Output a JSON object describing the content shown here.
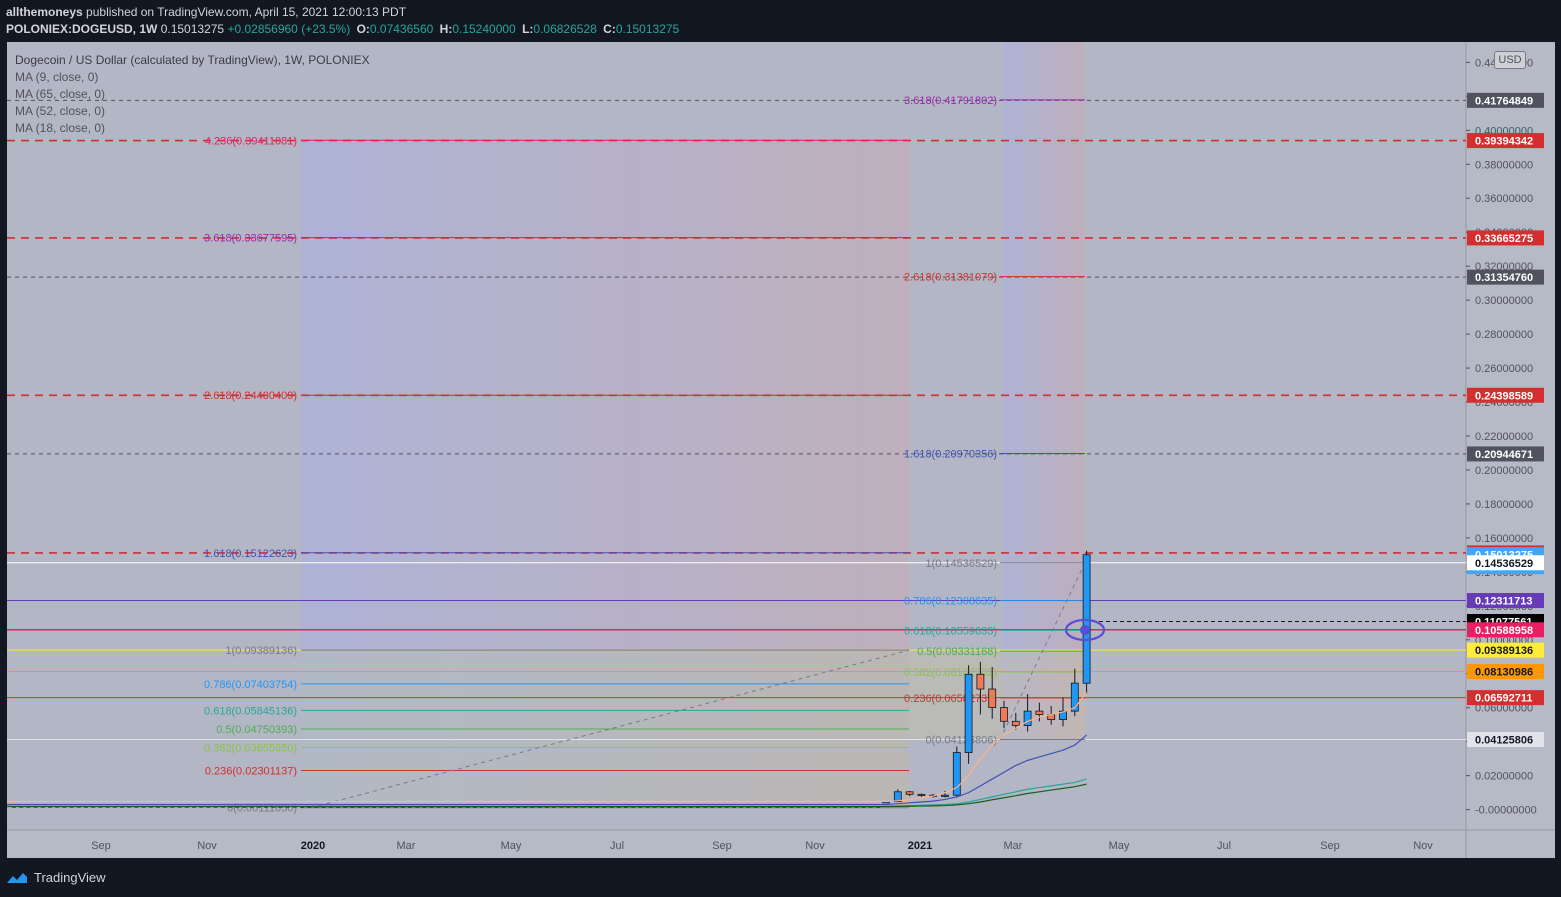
{
  "header": {
    "author": "allthemoneys",
    "published": "published on TradingView.com, April 15, 2021 12:00:13 PDT",
    "symbol": "POLONIEX:DOGEUSD, 1W",
    "last": "0.15013275",
    "change": "+0.02856960 (+23.5%)",
    "o_label": "O:",
    "o": "0.07436560",
    "h_label": "H:",
    "h": "0.15240000",
    "l_label": "L:",
    "l": "0.06826528",
    "c_label": "C:",
    "c": "0.15013275"
  },
  "legend": {
    "title": "Dogecoin / US Dollar (calculated by TradingView), 1W, POLONIEX",
    "ma1": "MA (9, close, 0)",
    "ma2": "MA (65, close, 0)",
    "ma3": "MA (52, close, 0)",
    "ma4": "MA (18, close, 0)"
  },
  "currency": "USD",
  "footer": {
    "brand": "TradingView"
  },
  "colors": {
    "background": "#b3b6c4",
    "frame": "#131722",
    "up": "#2196f3",
    "down": "#ef7b56",
    "dashed_red": "#d32f2f",
    "dashed_dark": "#50535e"
  },
  "chart_data": {
    "type": "candlestick",
    "ylim": [
      -0.012,
      0.452
    ],
    "y_ticks": [
      0.44,
      0.42,
      0.4,
      0.38,
      0.36,
      0.34,
      0.32,
      0.3,
      0.28,
      0.26,
      0.24,
      0.22,
      0.2,
      0.18,
      0.16,
      0.14,
      0.12,
      0.1,
      0.08,
      0.06,
      0.04,
      0.02,
      0.0
    ],
    "y_tick_labels": [
      "0.44000000",
      "0.42000000",
      "0.40000000",
      "0.38000000",
      "0.36000000",
      "0.34000000",
      "0.32000000",
      "0.30000000",
      "0.28000000",
      "0.26000000",
      "0.24000000",
      "0.22000000",
      "0.20000000",
      "0.18000000",
      "0.16000000",
      "0.14000000",
      "0.12000000",
      "0.10000000",
      "0.08000000",
      "0.06000000",
      "0.04000000",
      "0.02000000",
      "-0.00000000"
    ],
    "x_labels": [
      "Sep",
      "Nov",
      "2020",
      "Mar",
      "May",
      "Jul",
      "Sep",
      "Nov",
      "2021",
      "Mar",
      "May",
      "Jul",
      "Sep",
      "Nov"
    ],
    "x_bold": [
      "2020",
      "2021"
    ],
    "price_labels": [
      {
        "text": "0.41764849",
        "bg": "#50535e",
        "fg": "#ffffff",
        "value": 0.41764849
      },
      {
        "text": "0.39394342",
        "bg": "#d32f2f",
        "fg": "#ffffff",
        "value": 0.39394342
      },
      {
        "text": "0.33665275",
        "bg": "#d32f2f",
        "fg": "#ffffff",
        "value": 0.33665275
      },
      {
        "text": "0.31354760",
        "bg": "#50535e",
        "fg": "#ffffff",
        "value": 0.3135476
      },
      {
        "text": "0.24398589",
        "bg": "#d32f2f",
        "fg": "#ffffff",
        "value": 0.24398589
      },
      {
        "text": "0.20944671",
        "bg": "#50535e",
        "fg": "#ffffff",
        "value": 0.20944671
      },
      {
        "text": "0.15116249",
        "bg": "#d32f2f",
        "fg": "#ffffff",
        "value": 0.15116249
      },
      {
        "text": "0.15013275",
        "bg": "#42a5f5",
        "fg": "#ffffff",
        "value": 0.15013275,
        "sub": "3d 5h"
      },
      {
        "text": "0.14536529",
        "bg": "#ffffff",
        "fg": "#131722",
        "value": 0.14536529
      },
      {
        "text": "0.12311713",
        "bg": "#673ab7",
        "fg": "#ffffff",
        "value": 0.12311713
      },
      {
        "text": "0.11077561",
        "bg": "#000000",
        "fg": "#ffffff",
        "value": 0.11077561
      },
      {
        "text": "0.10588958",
        "bg": "#e91e63",
        "fg": "#ffffff",
        "value": 0.10588958
      },
      {
        "text": "0.09389136",
        "bg": "#ffeb3b",
        "fg": "#131722",
        "value": 0.09389136
      },
      {
        "text": "0.08130986",
        "bg": "#ff9800",
        "fg": "#131722",
        "value": 0.08130986
      },
      {
        "text": "0.06592711",
        "bg": "#d32f2f",
        "fg": "#ffffff",
        "value": 0.06592711
      },
      {
        "text": "0.04125806",
        "bg": "#e1e3ea",
        "fg": "#131722",
        "value": 0.04125806
      }
    ],
    "dashed_levels": [
      {
        "value": 0.41764849,
        "color": "#50535e"
      },
      {
        "value": 0.39394342,
        "color": "#d32f2f"
      },
      {
        "value": 0.33665275,
        "color": "#d32f2f"
      },
      {
        "value": 0.3135476,
        "color": "#50535e"
      },
      {
        "value": 0.24398589,
        "color": "#d32f2f"
      },
      {
        "value": 0.20944671,
        "color": "#50535e"
      },
      {
        "value": 0.15116249,
        "color": "#d32f2f"
      }
    ],
    "fib_left": [
      {
        "text": "4.236(0.39411081)",
        "value": 0.39411081,
        "color": "#e91e63"
      },
      {
        "text": "3.618(0.33677595)",
        "value": 0.33677595,
        "color": "#9c27b0"
      },
      {
        "text": "2.618(0.24400409)",
        "value": 0.24400409,
        "color": "#d32f2f"
      },
      {
        "text": "1.618(0.15122623)",
        "value": 0.15122623,
        "color": "#3f51b5"
      },
      {
        "text": "1(0.09389136)",
        "value": 0.09389136,
        "color": "#787b86"
      },
      {
        "text": "0.786(0.07403754)",
        "value": 0.07403754,
        "color": "#2196f3"
      },
      {
        "text": "0.618(0.05845136)",
        "value": 0.05845136,
        "color": "#26a69a"
      },
      {
        "text": "0.5(0.04750393)",
        "value": 0.04750393,
        "color": "#4caf50"
      },
      {
        "text": "0.382(0.03655650)",
        "value": 0.0365565,
        "color": "#8bc34a"
      },
      {
        "text": "0.236(0.02301137)",
        "value": 0.02301137,
        "color": "#d32f2f"
      },
      {
        "text": "0(0.00111650)",
        "value": 0.0011165,
        "color": "#787b86"
      }
    ],
    "fib_right": [
      {
        "text": "3.618(0.41791802)",
        "value": 0.41791802,
        "color": "#9c27b0"
      },
      {
        "text": "2.618(0.31381079)",
        "value": 0.31381079,
        "color": "#d32f2f"
      },
      {
        "text": "1.618(0.20970356)",
        "value": 0.20970356,
        "color": "#3f51b5"
      },
      {
        "text": "1(0.14536529)",
        "value": 0.14536529,
        "color": "#787b86"
      },
      {
        "text": "0.786(0.12308635)",
        "value": 0.12308635,
        "color": "#2196f3"
      },
      {
        "text": "0.618(0.10559633)",
        "value": 0.10559633,
        "color": "#26a69a"
      },
      {
        "text": "0.5(0.09331168)",
        "value": 0.09331168,
        "color": "#4caf50"
      },
      {
        "text": "0.382(0.08102702)",
        "value": 0.08102702,
        "color": "#8bc34a"
      },
      {
        "text": "0.236(0.06582737)",
        "value": 0.06582737,
        "color": "#d32f2f"
      },
      {
        "text": "0(0.04125806)",
        "value": 0.04125806,
        "color": "#787b86"
      }
    ],
    "candles": [
      {
        "o": 0.0042,
        "h": 0.005,
        "l": 0.004,
        "c": 0.0047
      },
      {
        "o": 0.0047,
        "h": 0.012,
        "l": 0.0045,
        "c": 0.0105
      },
      {
        "o": 0.0105,
        "h": 0.011,
        "l": 0.008,
        "c": 0.009
      },
      {
        "o": 0.009,
        "h": 0.0095,
        "l": 0.0075,
        "c": 0.0085
      },
      {
        "o": 0.0085,
        "h": 0.0092,
        "l": 0.007,
        "c": 0.0078
      },
      {
        "o": 0.0078,
        "h": 0.011,
        "l": 0.0072,
        "c": 0.0085
      },
      {
        "o": 0.0085,
        "h": 0.0372,
        "l": 0.0078,
        "c": 0.0336
      },
      {
        "o": 0.0336,
        "h": 0.085,
        "l": 0.027,
        "c": 0.0797
      },
      {
        "o": 0.0797,
        "h": 0.087,
        "l": 0.056,
        "c": 0.071
      },
      {
        "o": 0.071,
        "h": 0.084,
        "l": 0.0535,
        "c": 0.0601
      },
      {
        "o": 0.0601,
        "h": 0.064,
        "l": 0.048,
        "c": 0.052
      },
      {
        "o": 0.052,
        "h": 0.057,
        "l": 0.047,
        "c": 0.0495
      },
      {
        "o": 0.0495,
        "h": 0.068,
        "l": 0.046,
        "c": 0.058
      },
      {
        "o": 0.058,
        "h": 0.063,
        "l": 0.052,
        "c": 0.056
      },
      {
        "o": 0.056,
        "h": 0.061,
        "l": 0.05,
        "c": 0.053
      },
      {
        "o": 0.053,
        "h": 0.066,
        "l": 0.049,
        "c": 0.058
      },
      {
        "o": 0.058,
        "h": 0.083,
        "l": 0.055,
        "c": 0.0745
      },
      {
        "o": 0.0744,
        "h": 0.1524,
        "l": 0.0683,
        "c": 0.1501
      }
    ],
    "ma_series": [
      {
        "name": "MA (9, close, 0)",
        "color": "#ffb28a",
        "values": [
          0.0048,
          0.0052,
          0.006,
          0.007,
          0.008,
          0.01,
          0.013,
          0.02,
          0.03,
          0.038,
          0.044,
          0.048,
          0.052,
          0.0545,
          0.056,
          0.0575,
          0.06,
          0.069
        ]
      },
      {
        "name": "MA (18, close, 0)",
        "color": "#3f51b5",
        "values": [
          0.003,
          0.0035,
          0.004,
          0.0045,
          0.005,
          0.006,
          0.0075,
          0.01,
          0.014,
          0.018,
          0.022,
          0.026,
          0.029,
          0.031,
          0.033,
          0.035,
          0.038,
          0.044
        ]
      },
      {
        "name": "MA (52, close, 0)",
        "color": "#26a69a",
        "values": [
          0.002,
          0.0022,
          0.0024,
          0.0026,
          0.0028,
          0.003,
          0.0035,
          0.0045,
          0.006,
          0.0075,
          0.009,
          0.0105,
          0.012,
          0.013,
          0.014,
          0.015,
          0.016,
          0.018
        ]
      },
      {
        "name": "MA (65, close, 0)",
        "color": "#1b5e20",
        "values": [
          0.0018,
          0.0019,
          0.002,
          0.0021,
          0.0022,
          0.0024,
          0.0028,
          0.0035,
          0.0045,
          0.0058,
          0.007,
          0.0082,
          0.0095,
          0.0105,
          0.0115,
          0.0125,
          0.0135,
          0.015
        ]
      }
    ]
  }
}
